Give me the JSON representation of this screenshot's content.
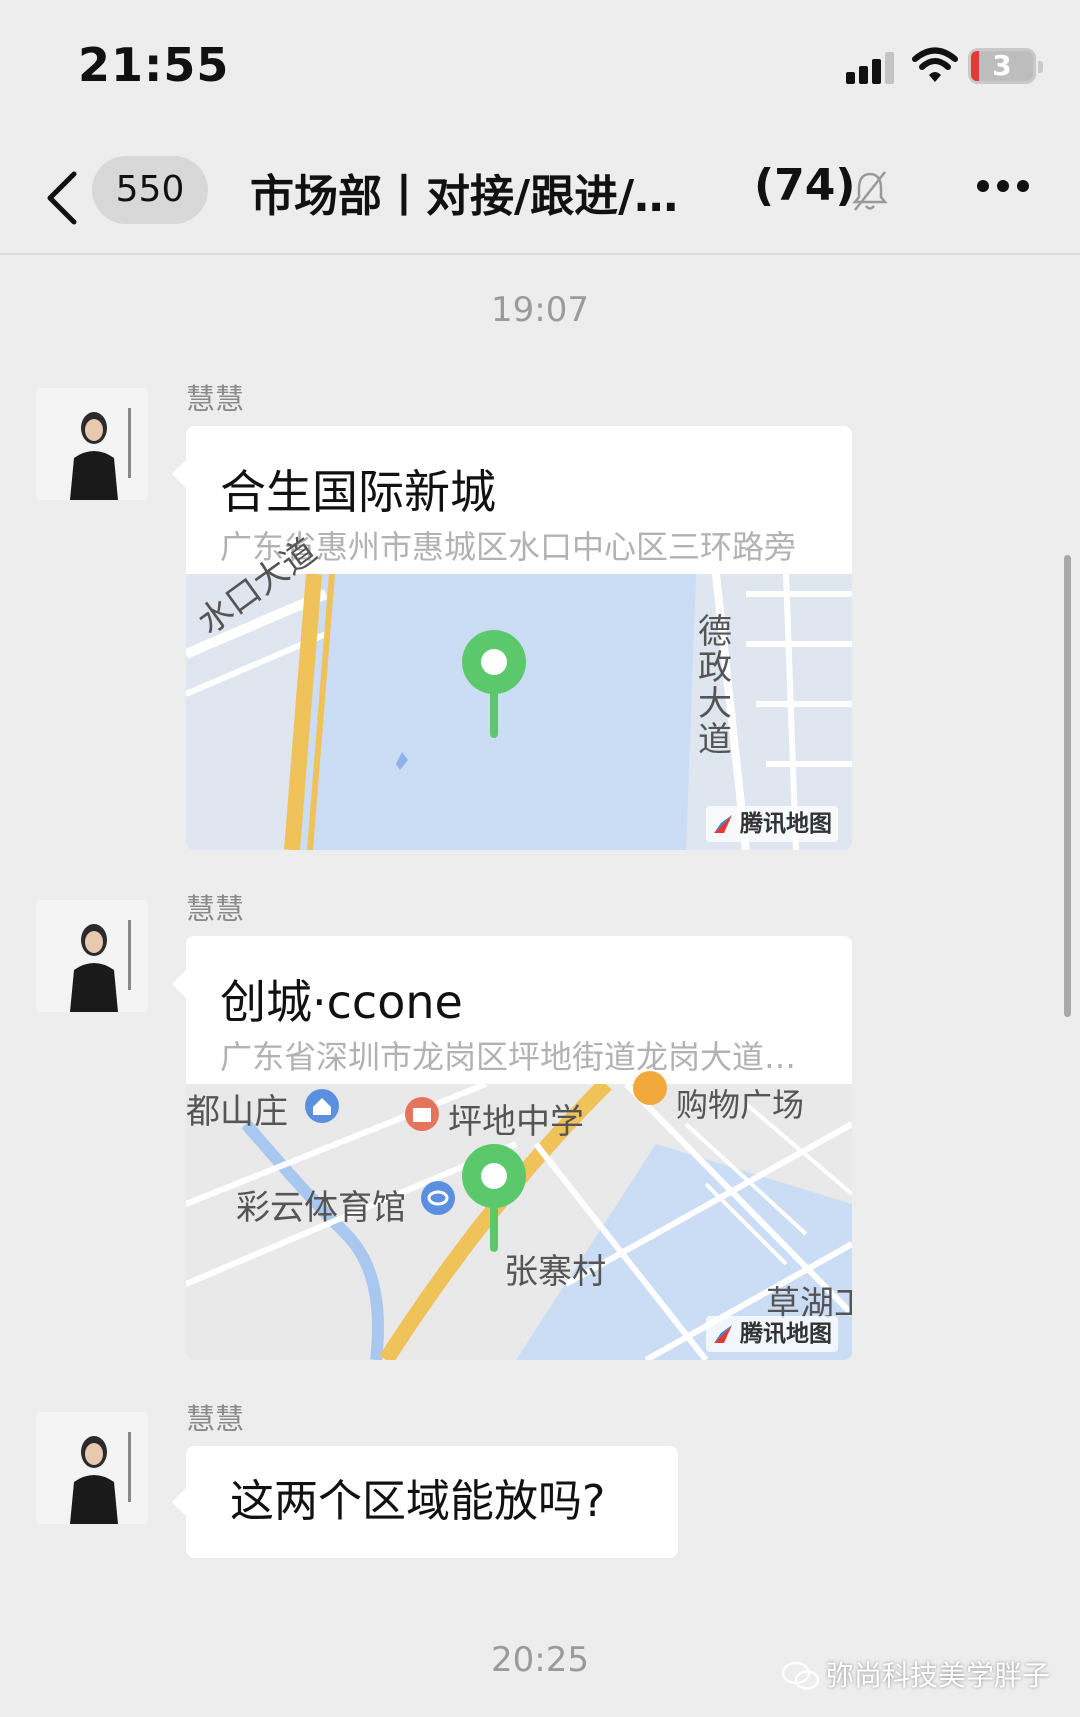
{
  "status_bar": {
    "time": "21:55",
    "battery_level": "3",
    "icons": [
      "cellular-signal-icon",
      "wifi-icon",
      "battery-icon"
    ]
  },
  "nav": {
    "unread_count": "550",
    "title": "市场部丨对接/跟进/…",
    "member_count": "(74)",
    "icons": [
      "back-chevron-icon",
      "muted-bell-icon",
      "more-dots-icon"
    ]
  },
  "timestamps": {
    "first": "19:07",
    "second": "20:25"
  },
  "messages": [
    {
      "sender": "慧慧",
      "type": "location",
      "place_name": "合生国际新城",
      "address": "广东省惠州市惠城区水口中心区三环路旁",
      "map_labels": [
        "水口大道",
        "德政大道"
      ],
      "map_brand": "腾讯地图"
    },
    {
      "sender": "慧慧",
      "type": "location",
      "place_name": "创城·ccone",
      "address": "广东省深圳市龙岗区坪地街道龙岗大道…",
      "map_labels": [
        "都山庄",
        "坪地中学",
        "购物广场",
        "彩云体育馆",
        "张寨村",
        "草湖工"
      ],
      "map_brand": "腾讯地图"
    },
    {
      "sender": "慧慧",
      "type": "text",
      "text": "这两个区域能放吗?"
    }
  ],
  "watermark": "弥尚科技美学胖子",
  "colors": {
    "background": "#ededed",
    "bubble": "#ffffff",
    "pin": "#5bc96b",
    "road": "#f0c35a",
    "water": "#cbdcf5"
  }
}
